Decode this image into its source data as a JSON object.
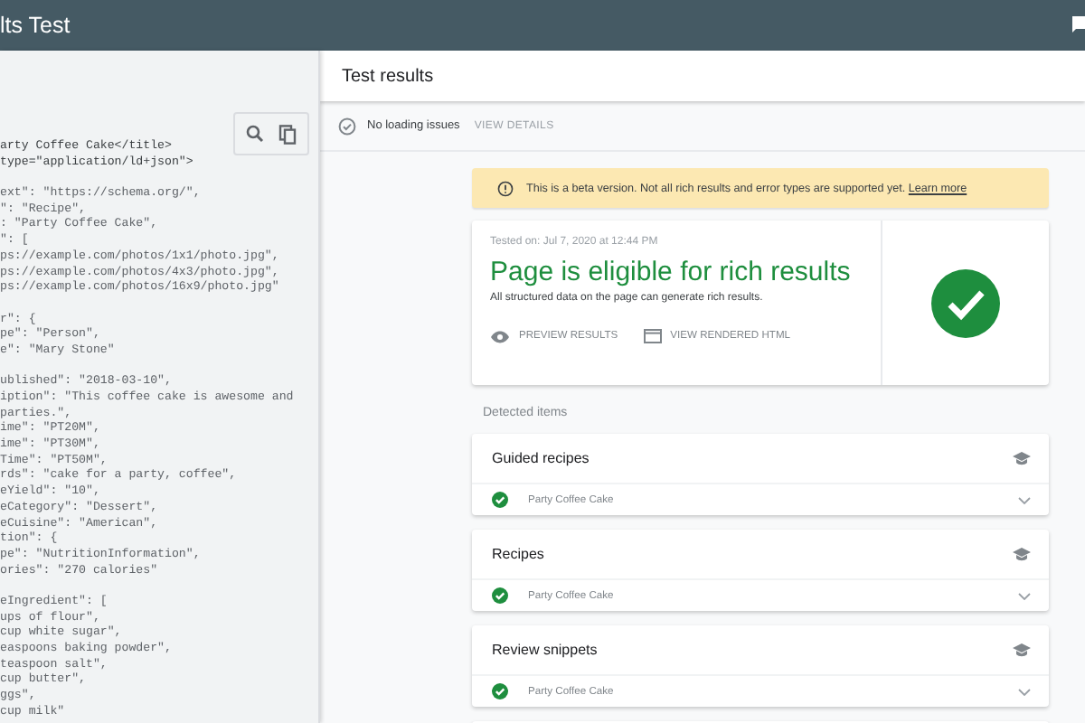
{
  "app_bar": {
    "title": "lts Test"
  },
  "code": {
    "blocks": [
      [
        "arty Coffee Cake</title>",
        "type=\"application/ld+json\">"
      ],
      [
        "ext\": \"https://schema.org/\",",
        "\": \"Recipe\",",
        ": \"Party Coffee Cake\",",
        "\": [",
        "ps://example.com/photos/1x1/photo.jpg\",",
        "ps://example.com/photos/4x3/photo.jpg\",",
        "ps://example.com/photos/16x9/photo.jpg\""
      ],
      [
        "r\": {",
        "pe\": \"Person\",",
        "e\": \"Mary Stone\""
      ],
      [
        "ublished\": \"2018-03-10\",",
        "iption\": \"This coffee cake is awesome and",
        "parties.\",",
        "ime\": \"PT20M\",",
        "ime\": \"PT30M\",",
        "Time\": \"PT50M\",",
        "rds\": \"cake for a party, coffee\",",
        "eYield\": \"10\",",
        "eCategory\": \"Dessert\",",
        "eCuisine\": \"American\",",
        "tion\": {",
        "pe\": \"NutritionInformation\",",
        "ories\": \"270 calories\""
      ],
      [
        "eIngredient\": [",
        "ups of flour\",",
        "cup white sugar\",",
        "easpoons baking powder\",",
        "teaspoon salt\",",
        "cup butter\",",
        "ggs\",",
        "cup milk\""
      ]
    ]
  },
  "results": {
    "title": "Test results",
    "loading": {
      "label": "No loading issues",
      "action": "VIEW DETAILS"
    },
    "banner": {
      "text": "This is a beta version. Not all rich results and error types are supported yet.",
      "link": "Learn more"
    },
    "summary": {
      "tested_on": "Tested on: Jul 7, 2020 at 12:44 PM",
      "headline": "Page is eligible for rich results",
      "description": "All structured data on the page can generate rich results.",
      "actions": [
        "PREVIEW RESULTS",
        "VIEW RENDERED HTML"
      ]
    },
    "detected_label": "Detected items",
    "items": [
      {
        "title": "Guided recipes",
        "entry": "Party Coffee Cake"
      },
      {
        "title": "Recipes",
        "entry": "Party Coffee Cake"
      },
      {
        "title": "Review snippets",
        "entry": "Party Coffee Cake"
      }
    ]
  }
}
